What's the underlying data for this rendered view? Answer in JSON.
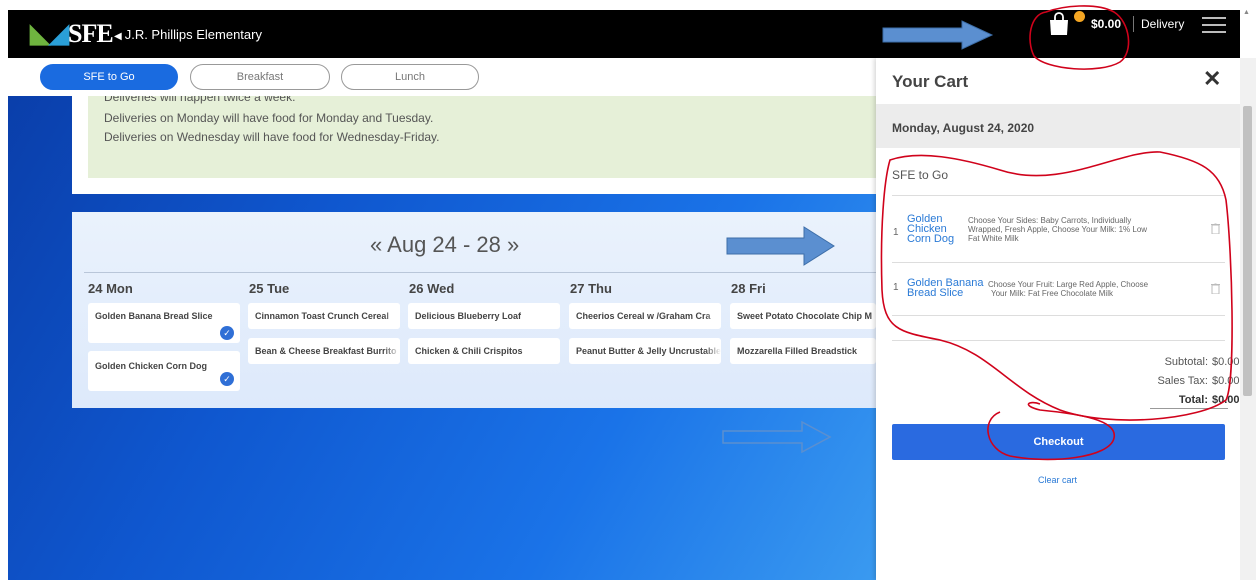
{
  "header": {
    "logo": "SFE",
    "school_name": "J.R. Phillips Elementary",
    "cart_total": "$0.00",
    "delivery_label": "Delivery"
  },
  "tabs": [
    {
      "label": "SFE to Go",
      "active": true
    },
    {
      "label": "Breakfast",
      "active": false
    },
    {
      "label": "Lunch",
      "active": false
    }
  ],
  "info": {
    "lines": [
      "Deliveries will happen twice a week.",
      "Deliveries on Monday will have food for Monday and Tuesday.",
      "Deliveries on Wednesday will have food for Wednesday-Friday."
    ]
  },
  "calendar": {
    "prev_label": "«",
    "range_label": "Aug 24 - 28",
    "next_label": "»",
    "days": [
      {
        "num": "24",
        "name": "Mon",
        "items": [
          "Golden Banana Bread Slice",
          "Golden Chicken Corn Dog"
        ]
      },
      {
        "num": "25",
        "name": "Tue",
        "items": [
          "Cinnamon Toast Crunch Cereal",
          "Bean & Cheese Breakfast Burrito"
        ]
      },
      {
        "num": "26",
        "name": "Wed",
        "items": [
          "Delicious Blueberry Loaf",
          "Chicken & Chili Crispitos"
        ]
      },
      {
        "num": "27",
        "name": "Thu",
        "items": [
          "Cheerios Cereal w /Graham Cra",
          "Peanut Butter & Jelly Uncrustables"
        ]
      },
      {
        "num": "28",
        "name": "Fri",
        "items": [
          "Sweet Potato Chocolate Chip M",
          "Mozzarella Filled Breadstick"
        ]
      }
    ]
  },
  "cart": {
    "title": "Your Cart",
    "close": "✕",
    "date": "Monday, August 24, 2020",
    "section": "SFE to Go",
    "items": [
      {
        "qty": "1",
        "name_lines": [
          "Golden",
          "Chicken",
          "Corn Dog"
        ],
        "desc_lines": [
          "Choose Your Sides: Baby Carrots, Individually",
          "Wrapped, Fresh Apple, Choose Your Milk: 1% Low",
          "Fat White Milk"
        ]
      },
      {
        "qty": "1",
        "name_lines": [
          "Golden Banana",
          "Bread Slice"
        ],
        "desc_lines": [
          "Choose Your Fruit: Large Red Apple, Choose",
          "Your Milk: Fat Free Chocolate Milk"
        ]
      }
    ],
    "subtotal_label": "Subtotal:",
    "subtotal": "$0.00",
    "tax_label": "Sales Tax:",
    "tax": "$0.00",
    "total_label": "Total:",
    "total": "$0.00",
    "checkout_label": "Checkout",
    "clear_label": "Clear cart"
  },
  "colors": {
    "accent": "#2a6ae0",
    "annotation": "#d0021b",
    "arrow": "#5b8fd0"
  }
}
